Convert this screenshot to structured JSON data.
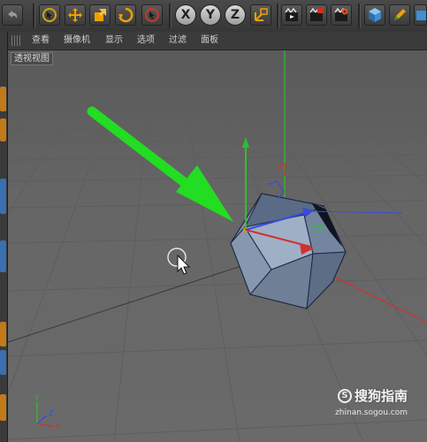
{
  "toolbar": {
    "axis_x": "X",
    "axis_y": "Y",
    "axis_z": "Z",
    "icons": [
      "undo-icon",
      "live-select-icon",
      "move-icon",
      "scale-icon",
      "rotate-icon",
      "recent-tool-icon",
      "axis-x-icon",
      "axis-y-icon",
      "axis-z-icon",
      "world-coordinates-icon",
      "render-view-icon",
      "render-picture-viewer-icon",
      "render-settings-icon",
      "cube-icon",
      "pen-icon",
      "subdivide-icon"
    ]
  },
  "menu": {
    "items": [
      "查看",
      "摄像机",
      "显示",
      "选项",
      "过滤",
      "面板"
    ]
  },
  "viewport": {
    "label": "透视视图"
  },
  "watermark": {
    "brand": "搜狗指南",
    "url": "zhinan.sogou.com"
  },
  "colors": {
    "toolbar_bg": "#3f3f3f",
    "viewport_bg": "#666666",
    "grid_line": "#5b5b5b",
    "axis_x": "#d23030",
    "axis_y": "#2fbf2f",
    "axis_z": "#3a4bd8",
    "object": "#8c98a8",
    "annotation_arrow": "#22dd22"
  }
}
